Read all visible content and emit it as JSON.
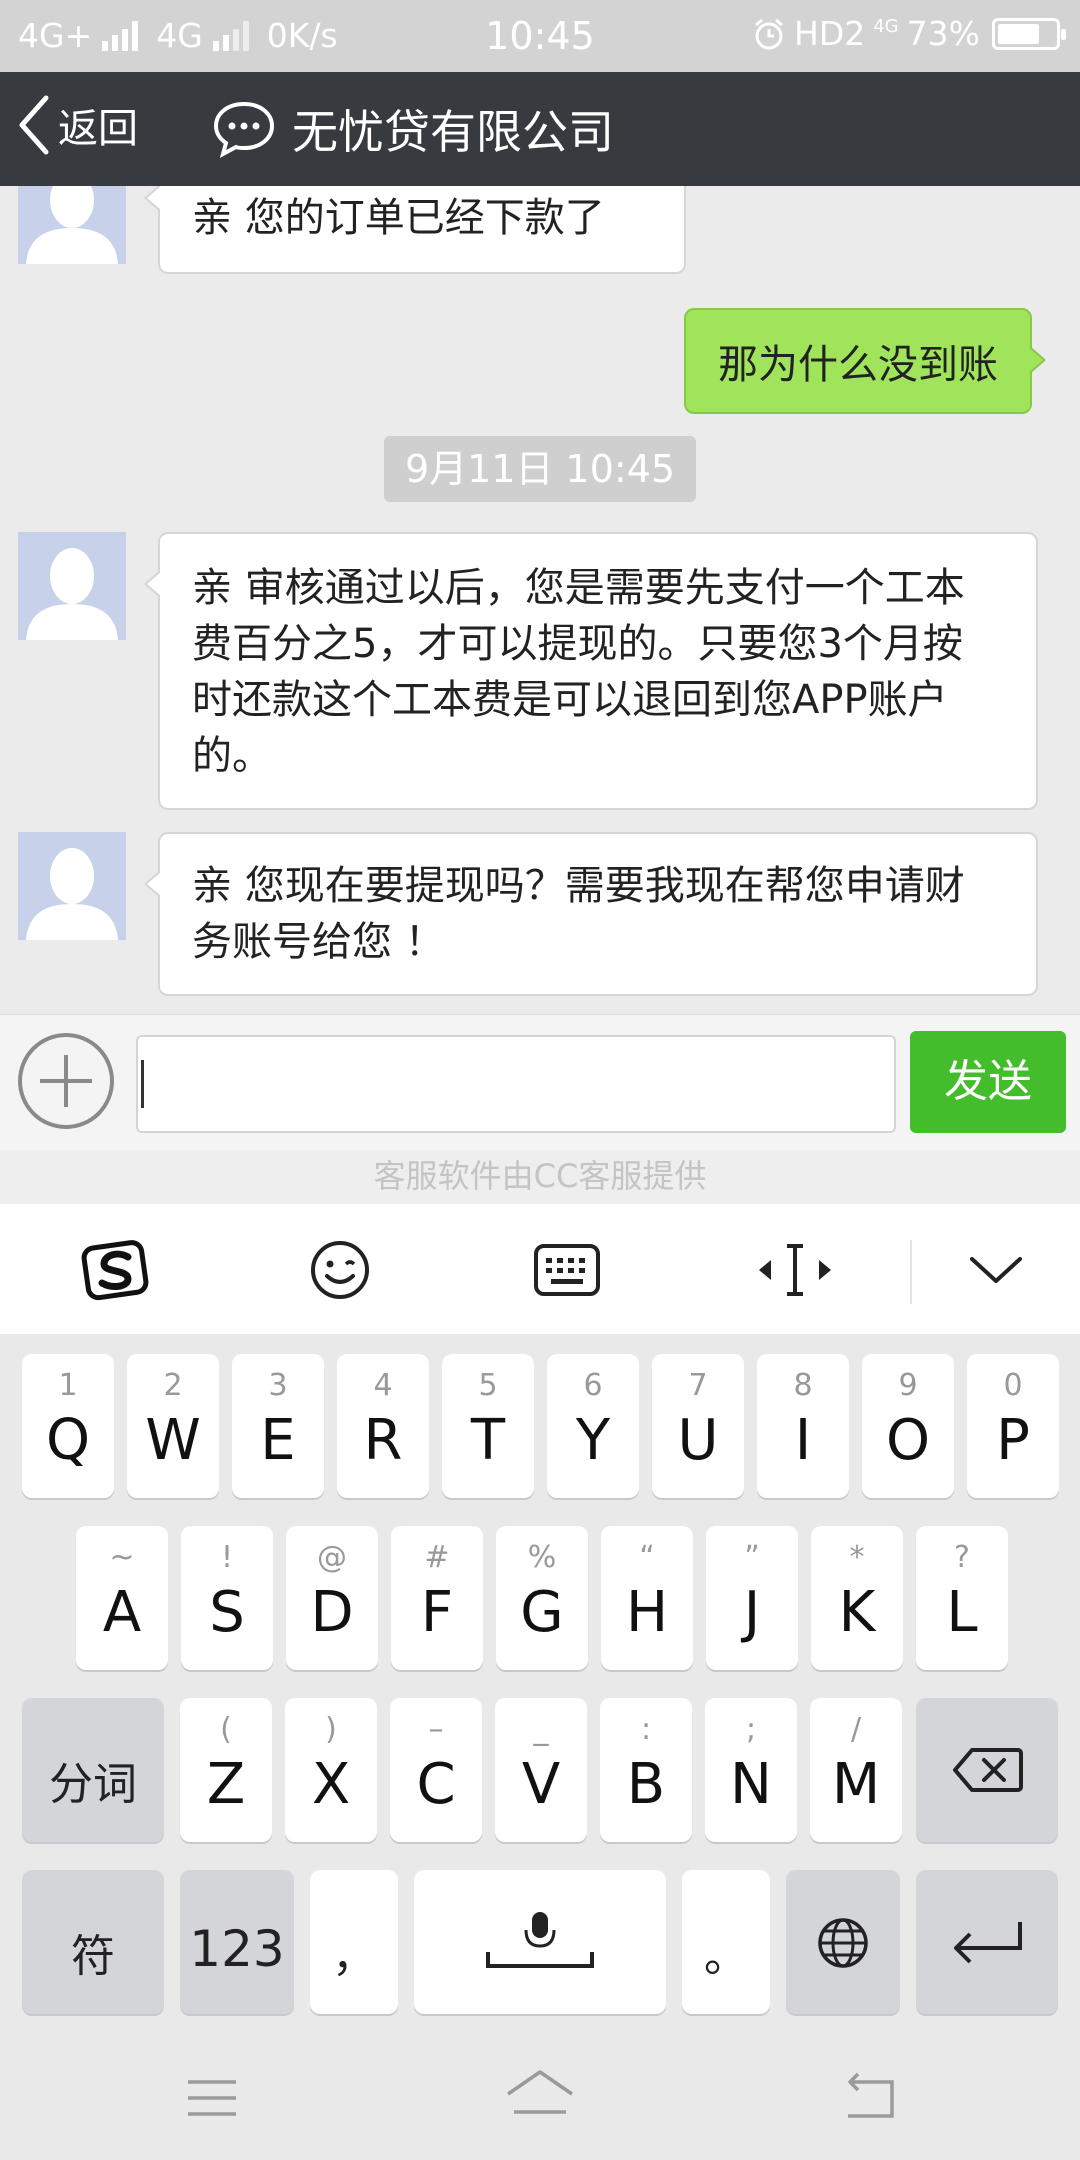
{
  "status_bar": {
    "network1": "4G+",
    "network2": "4G",
    "speed": "0K/s",
    "time": "10:45",
    "hd": "HD2",
    "net3": "4G",
    "battery_percent": "73%",
    "battery_level": 0.73
  },
  "navbar": {
    "back_label": "返回",
    "title": "无忧贷有限公司"
  },
  "chat": {
    "messages": [
      {
        "side": "left",
        "text": "亲 您的订单已经下款了"
      },
      {
        "side": "right",
        "text": "那为什么没到账"
      },
      {
        "side": "left",
        "text": "亲 审核通过以后，您是需要先支付一个工本费百分之5，才可以提现的。只要您3个月按时还款这个工本费是可以退回到您APP账户的。"
      },
      {
        "side": "left",
        "text": "亲 您现在要提现吗？需要我现在帮您申请财务账号给您 ！"
      }
    ],
    "timestamp": "9月11日 10:45"
  },
  "input": {
    "value": "",
    "send_label": "发送",
    "provider_note": "客服软件由CC客服提供"
  },
  "keyboard": {
    "row1": [
      {
        "hint": "1",
        "ch": "Q"
      },
      {
        "hint": "2",
        "ch": "W"
      },
      {
        "hint": "3",
        "ch": "E"
      },
      {
        "hint": "4",
        "ch": "R"
      },
      {
        "hint": "5",
        "ch": "T"
      },
      {
        "hint": "6",
        "ch": "Y"
      },
      {
        "hint": "7",
        "ch": "U"
      },
      {
        "hint": "8",
        "ch": "I"
      },
      {
        "hint": "9",
        "ch": "O"
      },
      {
        "hint": "0",
        "ch": "P"
      }
    ],
    "row2": [
      {
        "hint": "~",
        "ch": "A"
      },
      {
        "hint": "!",
        "ch": "S"
      },
      {
        "hint": "@",
        "ch": "D"
      },
      {
        "hint": "#",
        "ch": "F"
      },
      {
        "hint": "%",
        "ch": "G"
      },
      {
        "hint": "“",
        "ch": "H"
      },
      {
        "hint": "”",
        "ch": "J"
      },
      {
        "hint": "*",
        "ch": "K"
      },
      {
        "hint": "?",
        "ch": "L"
      }
    ],
    "row3": [
      {
        "hint": "(",
        "ch": "Z"
      },
      {
        "hint": ")",
        "ch": "X"
      },
      {
        "hint": "–",
        "ch": "C"
      },
      {
        "hint": "_",
        "ch": "V"
      },
      {
        "hint": ":",
        "ch": "B"
      },
      {
        "hint": ";",
        "ch": "N"
      },
      {
        "hint": "/",
        "ch": "M"
      }
    ],
    "fenci_label": "分词",
    "symbols_label": "符",
    "num_label": "123",
    "comma_label": "，",
    "period_label": "。"
  },
  "icons": {
    "toolbar": [
      "sogou-logo-icon",
      "emoji-icon",
      "keyboard-icon",
      "cursor-move-icon",
      "chevron-down-icon"
    ],
    "nav": [
      "menu-icon",
      "home-icon",
      "back-icon"
    ]
  }
}
